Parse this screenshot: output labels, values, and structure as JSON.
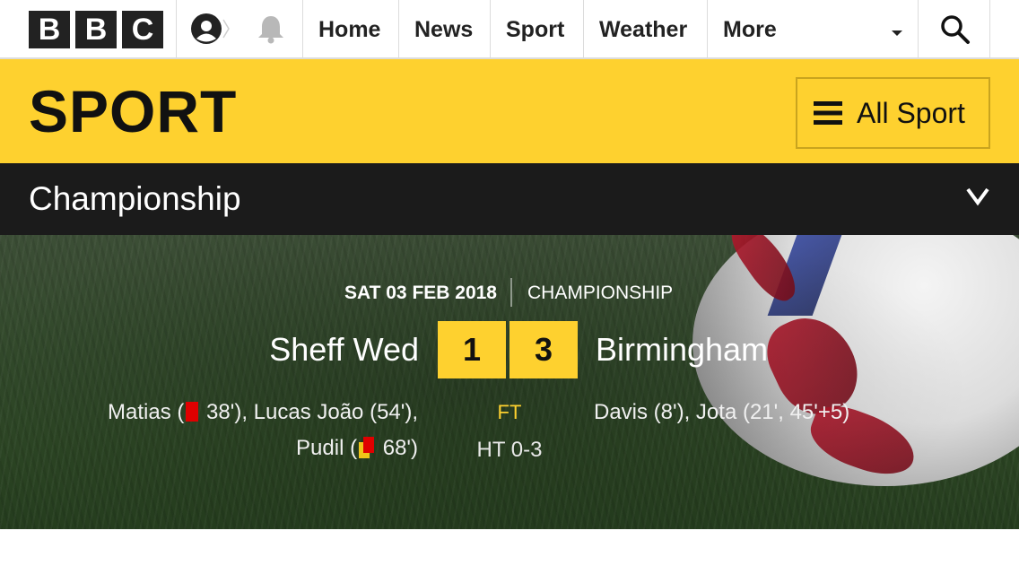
{
  "topnav": {
    "logo": [
      "B",
      "B",
      "C"
    ],
    "account_icon": "user-account-icon",
    "notification_icon": "bell-icon",
    "links": [
      "Home",
      "News",
      "Sport",
      "Weather",
      "More"
    ],
    "search_icon": "search-icon"
  },
  "banner": {
    "title": "SPORT",
    "all_sport_label": "All Sport",
    "menu_icon": "hamburger-menu-icon",
    "color": "#fed12f"
  },
  "section": {
    "title": "Championship",
    "chevron_icon": "chevron-down-icon"
  },
  "match": {
    "date": "SAT 03 FEB 2018",
    "competition": "CHAMPIONSHIP",
    "home_team": "Sheff Wed",
    "away_team": "Birmingham",
    "home_score": "1",
    "away_score": "3",
    "status": "FT",
    "half_time": "HT 0-3",
    "home_events_line1_a": "Matias (",
    "home_events_line1_b": " 38'), Lucas João (54'),",
    "home_events_line2_a": "Pudil (",
    "home_events_line2_b": " 68')",
    "away_events": "Davis (8'), Jota (21', 45'+5)",
    "red_card_icon": "red-card-icon",
    "second_yellow_icon": "second-yellow-card-icon"
  }
}
